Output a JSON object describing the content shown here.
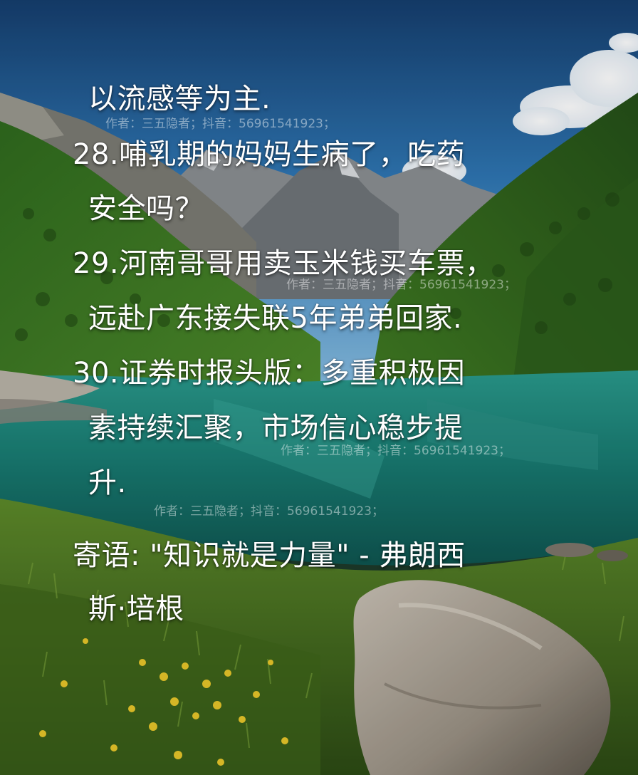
{
  "lines": [
    "以流感等为主.",
    "28.哺乳期的妈妈生病了，吃药",
    "安全吗？",
    "29.河南哥哥用卖玉米钱买车票，",
    "远赴广东接失联5年弟弟回家.",
    "30.证券时报头版：多重积极因",
    "素持续汇聚，市场信心稳步提",
    "升.",
    "寄语: \"知识就是力量\" - 弗朗西",
    "斯·培根"
  ],
  "watermark": "作者：三五隐者；抖音：56961541923；",
  "colors": {
    "sky_top": "#1f5f9e",
    "sky_bottom": "#7fb6df",
    "lake": "#1f8a80",
    "grass": "#4f7a22",
    "text": "#ffffff"
  }
}
